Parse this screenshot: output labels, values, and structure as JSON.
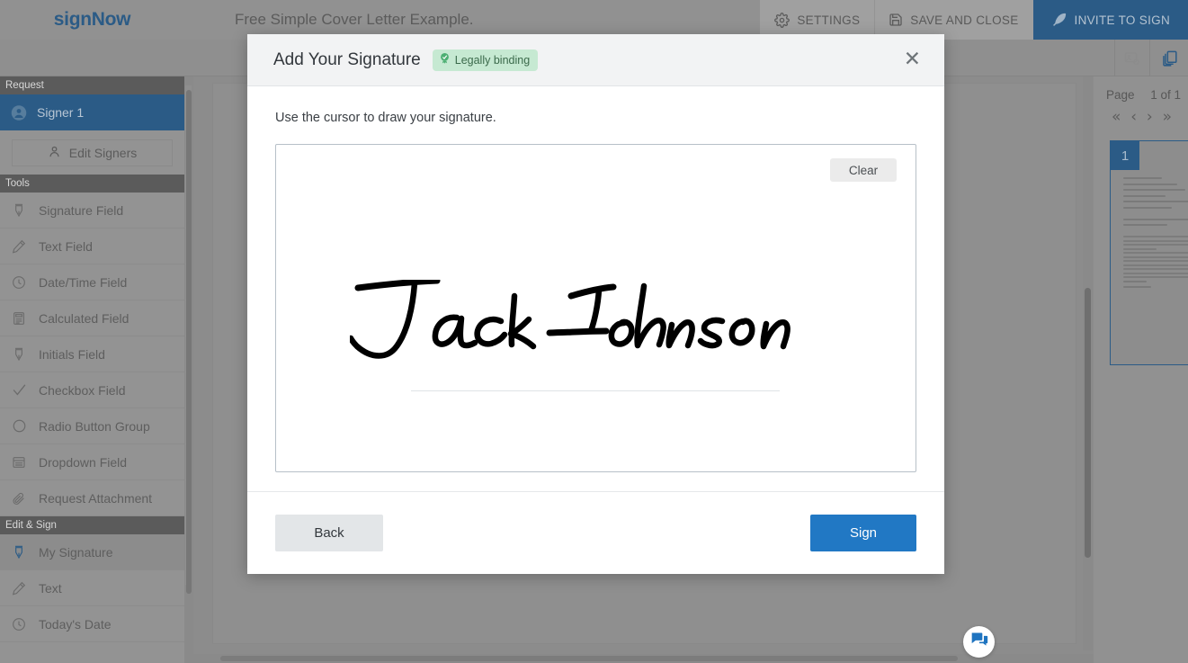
{
  "header": {
    "logo_sign": "sign",
    "logo_now": "Now",
    "document_title": "Free Simple Cover Letter Example.",
    "actions": [
      {
        "label": "SETTINGS",
        "icon": "gear-icon"
      },
      {
        "label": "SAVE AND CLOSE",
        "icon": "floppy-disk-icon"
      },
      {
        "label": "INVITE TO SIGN",
        "icon": "feather-quill-icon"
      }
    ]
  },
  "toolbar": {
    "icons": [
      {
        "name": "edit-image-icon",
        "state": "disabled"
      },
      {
        "name": "copy-pages-icon",
        "state": "active"
      }
    ]
  },
  "sidebar": {
    "sections": [
      {
        "header": "Request",
        "items": [
          {
            "label": "Signer 1",
            "icon": "user-avatar-icon",
            "selected": true
          }
        ]
      },
      {
        "header": "Tools",
        "items": [
          {
            "label": "Signature Field",
            "icon": "pen-nib-icon"
          },
          {
            "label": "Text Field",
            "icon": "pencil-icon"
          },
          {
            "label": "Date/Time Field",
            "icon": "clock-icon"
          },
          {
            "label": "Calculated Field",
            "icon": "calculator-icon"
          },
          {
            "label": "Initials Field",
            "icon": "pen-nib-icon"
          },
          {
            "label": "Checkbox Field",
            "icon": "check-icon"
          },
          {
            "label": "Radio Button Group",
            "icon": "circle-icon"
          },
          {
            "label": "Dropdown Field",
            "icon": "dropdown-icon"
          },
          {
            "label": "Request Attachment",
            "icon": "paperclip-icon"
          }
        ]
      },
      {
        "header": "Edit & Sign",
        "items": [
          {
            "label": "My Signature",
            "icon": "pen-nib-icon",
            "active": true
          },
          {
            "label": "Text",
            "icon": "pencil-icon"
          },
          {
            "label": "Today's Date",
            "icon": "clock-icon"
          }
        ]
      }
    ],
    "edit_signers_label": "Edit Signers",
    "edit_signers_icon": "person-icon"
  },
  "pages_panel": {
    "page_label": "Page",
    "page_count_text": "1 of 1",
    "nav": [
      {
        "name": "first-page-button",
        "glyph": "«"
      },
      {
        "name": "prev-page-button",
        "glyph": "‹"
      },
      {
        "name": "next-page-button",
        "glyph": "›"
      },
      {
        "name": "last-page-button",
        "glyph": "»"
      }
    ],
    "thumbnail_number": "1"
  },
  "chat": {
    "icon": "chat-bubbles-icon"
  },
  "modal": {
    "title": "Add Your Signature",
    "badge_label": "Legally binding",
    "badge_icon": "verified-rosette-icon",
    "badge_bg": "#c6e9d2",
    "close_icon": "close-icon",
    "instruction": "Use the cursor to draw your signature.",
    "clear_label": "Clear",
    "signature_text": "Jack Johnson",
    "back_label": "Back",
    "sign_label": "Sign",
    "sign_button_color": "#2178c4"
  }
}
